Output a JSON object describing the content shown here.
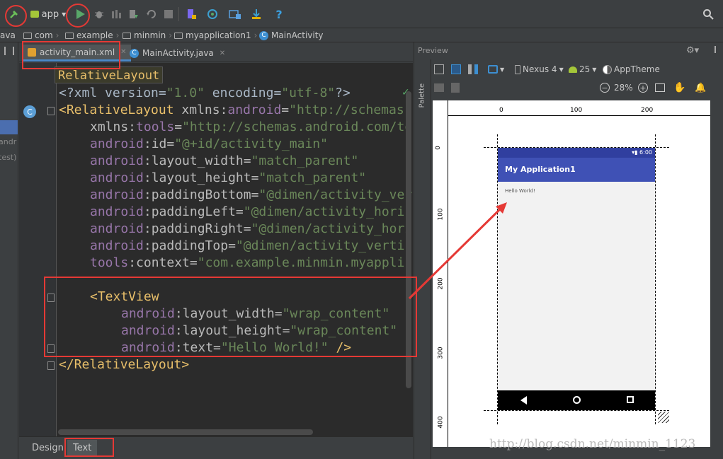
{
  "toolbar": {
    "run_config_label": "app",
    "icons": [
      "hammer-icon",
      "app-config-icon",
      "run-icon",
      "debug-icon",
      "attach-debugger-icon",
      "apply-changes-icon",
      "rerun-icon",
      "stop-icon",
      "avd-manager-icon",
      "sync-icon",
      "project-structure-icon",
      "sdk-manager-icon",
      "help-icon",
      "search-icon"
    ]
  },
  "breadcrumb": {
    "partial_left": "ava",
    "items": [
      "com",
      "example",
      "minmin",
      "myapplication1",
      "MainActivity"
    ]
  },
  "left_strip": {
    "partial_texts": [
      "andr",
      "test)"
    ]
  },
  "editor_tabs": [
    {
      "label": "activity_main.xml",
      "active": true
    },
    {
      "label": "MainActivity.java",
      "active": false
    }
  ],
  "tooltip": "RelativeLayout",
  "code": {
    "l1_a": "<?xml version=",
    "l1_b": "\"1.0\"",
    "l1_c": " encoding=",
    "l1_d": "\"utf-8\"",
    "l1_e": "?>",
    "l2_tag": "<RelativeLayout",
    "l2_attr": " xmlns:",
    "l2_ns": "android",
    "l2_eq": "=",
    "l2_val": "\"http://schemas.",
    "l3_attr": "xmlns:",
    "l3_ns": "tools",
    "l3_eq": "=",
    "l3_val": "\"http://schemas.android.com/to",
    "attr_lines": [
      {
        "ns": "android",
        "name": ":id=",
        "val": "\"@+id/activity_main\""
      },
      {
        "ns": "android",
        "name": ":layout_width=",
        "val": "\"match_parent\""
      },
      {
        "ns": "android",
        "name": ":layout_height=",
        "val": "\"match_parent\""
      },
      {
        "ns": "android",
        "name": ":paddingBottom=",
        "val": "\"@dimen/activity_ver"
      },
      {
        "ns": "android",
        "name": ":paddingLeft=",
        "val": "\"@dimen/activity_horiz"
      },
      {
        "ns": "android",
        "name": ":paddingRight=",
        "val": "\"@dimen/activity_hori"
      },
      {
        "ns": "android",
        "name": ":paddingTop=",
        "val": "\"@dimen/activity_vertic"
      },
      {
        "ns": "tools",
        "name": ":context=",
        "val": "\"com.example.minmin.myapplic"
      }
    ],
    "tv_open": "<TextView",
    "tv_attrs": [
      {
        "ns": "android",
        "name": ":layout_width=",
        "val": "\"wrap_content\"",
        "tail": ""
      },
      {
        "ns": "android",
        "name": ":layout_height=",
        "val": "\"wrap_content\"",
        "tail": ""
      },
      {
        "ns": "android",
        "name": ":text=",
        "val": "\"Hello World!\"",
        "tail": " />"
      }
    ],
    "close_tag": "</RelativeLayout>"
  },
  "bottom_tabs": [
    {
      "label": "Design",
      "active": false
    },
    {
      "label": "Text",
      "active": true
    }
  ],
  "preview": {
    "title": "Preview",
    "palette_label": "Palette",
    "device": "Nexus 4",
    "api": "25",
    "theme": "AppTheme",
    "zoom": "28%",
    "ruler_h": [
      "0",
      "100",
      "200"
    ],
    "ruler_v": [
      "0",
      "100",
      "200",
      "300",
      "400"
    ],
    "status_time": "6:00",
    "app_title": "My Application1",
    "hello_text": "Hello World!"
  },
  "watermark": "http://blog.csdn.net/minmin_1123",
  "colors": {
    "annotation": "#e53935",
    "app_bar": "#3f51b5",
    "status_bar": "#303f9f"
  }
}
